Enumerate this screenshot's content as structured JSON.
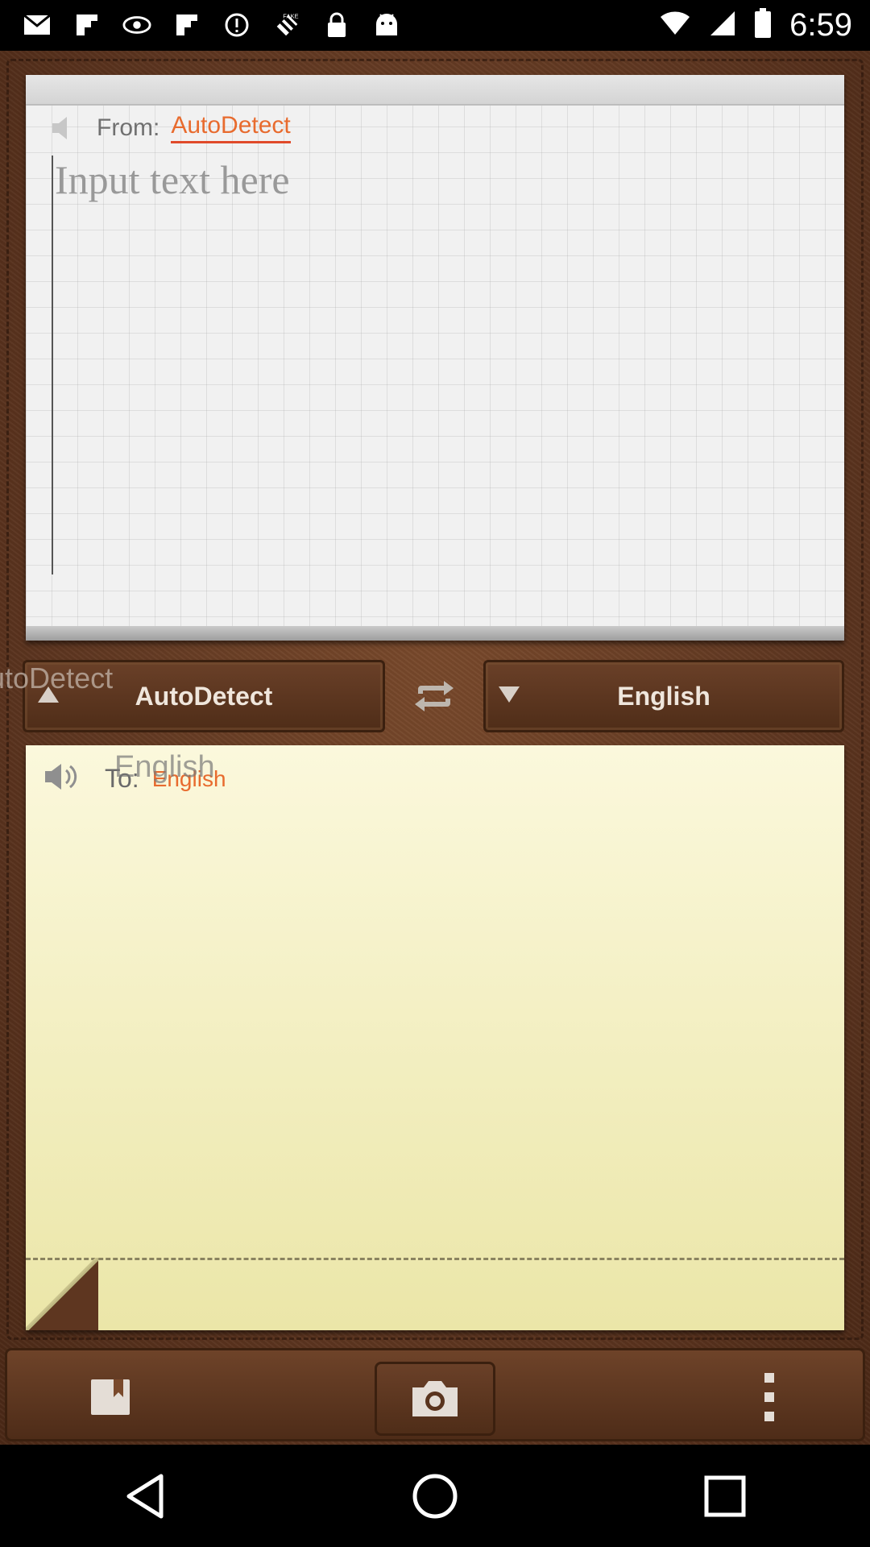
{
  "status_bar": {
    "time": "6:59",
    "icons": [
      "email-icon",
      "flipboard-icon",
      "eye-icon",
      "flipboard-icon",
      "alert-icon",
      "fake-gps-icon",
      "lock-icon",
      "android-icon"
    ],
    "fake_label": "FAKE"
  },
  "input": {
    "from_label": "From:",
    "from_value": "AutoDetect",
    "placeholder": "Input text here",
    "value": ""
  },
  "language_bar": {
    "ghost_text": "utoDetect",
    "source_language": "AutoDetect",
    "target_language": "English",
    "swap_icon": "swap-icon"
  },
  "output": {
    "to_label": "To:",
    "to_value": "English",
    "ghost_text": "English"
  },
  "toolbar": {
    "bookmark_icon": "bookmark-icon",
    "camera_icon": "camera-icon",
    "menu_icon": "more-vertical-icon"
  },
  "navigation": {
    "back": "back-icon",
    "home": "home-icon",
    "recents": "recents-icon"
  },
  "colors": {
    "accent": "#e86b2e",
    "leather": "#5e3620",
    "output_paper": "#f6f2c6",
    "input_paper": "#f1f1f1"
  }
}
